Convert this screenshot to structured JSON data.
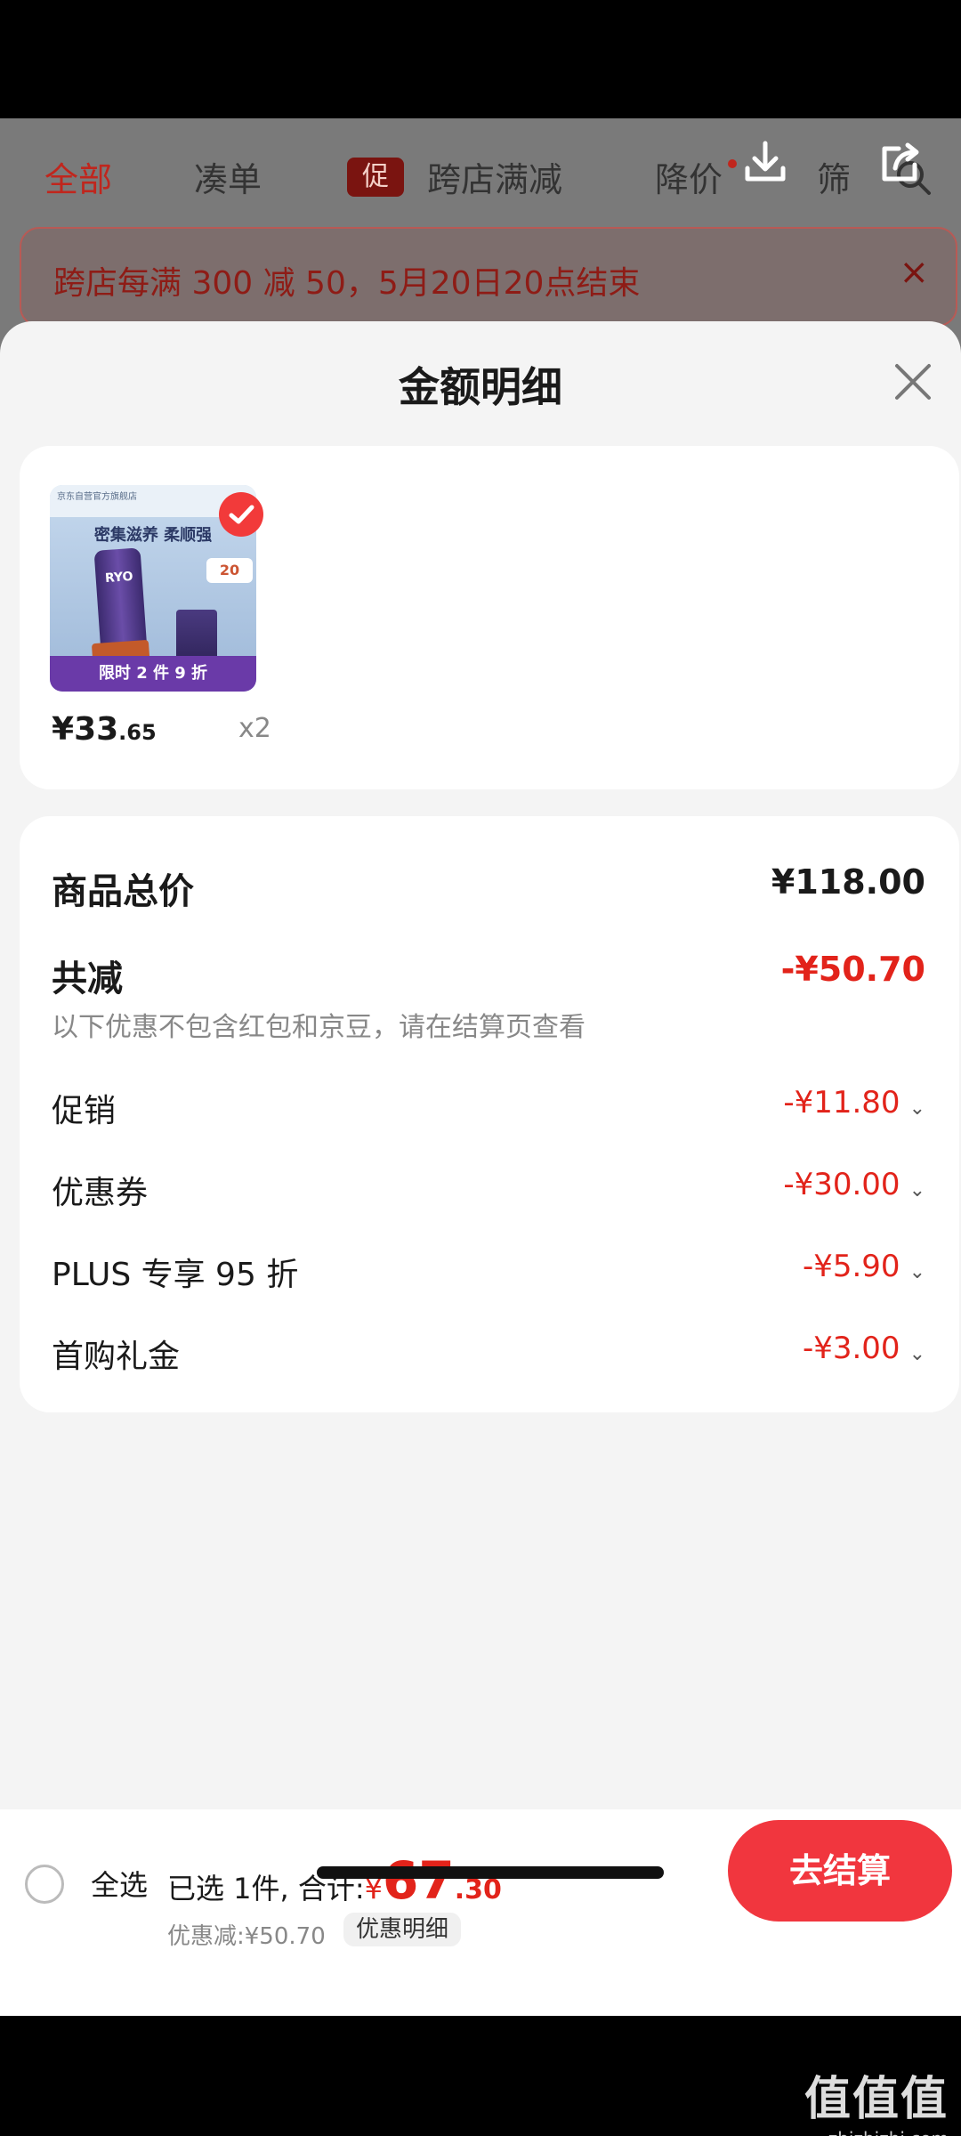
{
  "background_tabs": {
    "all": "全部",
    "combine": "凑单",
    "promo_tag": "促",
    "cross_store": "跨店满减",
    "price_drop": "降价",
    "filter": "筛"
  },
  "background_banner": {
    "text": "跨店每满 300 减 50，5月20日20点结束",
    "close": "×"
  },
  "sheet": {
    "title": "金额明细",
    "close": "×"
  },
  "product": {
    "thumb_top_text": "京东自营官方旗舰店",
    "thumb_slogan": "密集滋养 柔顺强",
    "thumb_tube_label": "RYO",
    "thumb_tag": "20",
    "thumb_strip": "限时 2 件 9 折",
    "price_yen": "¥",
    "price_int": "33",
    "price_dec": ".65",
    "qty": "x2"
  },
  "detail": {
    "subtotal_label": "商品总价",
    "subtotal_value": "¥118.00",
    "total_discount_label": "共减",
    "total_discount_value": "-¥50.70",
    "note": "以下优惠不包含红包和京豆，请在结算页查看",
    "items": [
      {
        "label": "促销",
        "value": "-¥11.80"
      },
      {
        "label": "优惠券",
        "value": "-¥30.00"
      },
      {
        "label": "PLUS 专享 95 折",
        "value": "-¥5.90"
      },
      {
        "label": "首购礼金",
        "value": "-¥3.00"
      }
    ]
  },
  "checkout": {
    "select_all": "全选",
    "selected_prefix": "已选 1件, 合计:",
    "total_yen": "¥",
    "total_int": "67",
    "total_dec": ".30",
    "discount_line": "优惠减:¥50.70",
    "detail_link": "优惠明细",
    "checkout_button": "去结算"
  },
  "watermark": {
    "logo": "值值值",
    "url": "zhizhizhi.com"
  },
  "colors": {
    "accent_red": "#e2231a",
    "button_red": "#f1363e",
    "badge_red": "#f23a3a"
  },
  "icons": [
    "download-icon",
    "share-icon",
    "search-icon",
    "close-icon",
    "check-icon",
    "chevron-down-icon"
  ]
}
